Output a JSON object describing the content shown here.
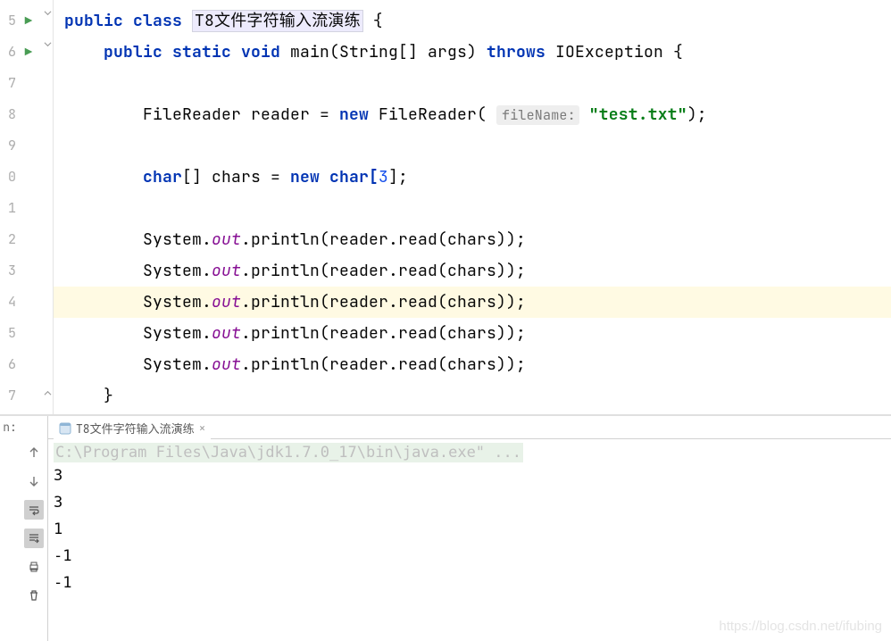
{
  "editor": {
    "line_numbers": [
      "5",
      "6",
      "7",
      "8",
      "9",
      "0",
      "1",
      "2",
      "3",
      "4",
      "5",
      "6",
      "7"
    ],
    "run_markers": [
      true,
      true,
      false,
      false,
      false,
      false,
      false,
      false,
      false,
      false,
      false,
      false,
      false
    ],
    "highlighted_line_index": 9,
    "code": {
      "kw_public": "public",
      "kw_class": "class",
      "class_name": "T8文件字符输入流演练",
      "brace_open": " {",
      "kw_static": "static",
      "kw_void": "void",
      "main": "main",
      "main_params": "(String[] args) ",
      "kw_throws": "throws",
      "exc": " IOException {",
      "filereader_decl": "FileReader reader = ",
      "kw_new": "new",
      "filereader_ctor": " FileReader( ",
      "hint_filename": "fileName:",
      "filename_str": " \"test.txt\"",
      "close_paren_semi": ");",
      "kw_char": "char",
      "chars_decl": "[] chars = ",
      "char_arr": " char[",
      "arr_size": "3",
      "arr_close": "];",
      "sys": "System.",
      "out": "out",
      "println_call": ".println(reader.read(chars));",
      "close_brace": "}"
    }
  },
  "run_panel": {
    "label": "n:",
    "tab_label": "T8文件字符输入流演练",
    "cmd_line": "C:\\Program Files\\Java\\jdk1.7.0_17\\bin\\java.exe\" ...",
    "output": [
      "3",
      "3",
      "1",
      "-1",
      "-1"
    ]
  },
  "watermark": "https://blog.csdn.net/ifubing"
}
